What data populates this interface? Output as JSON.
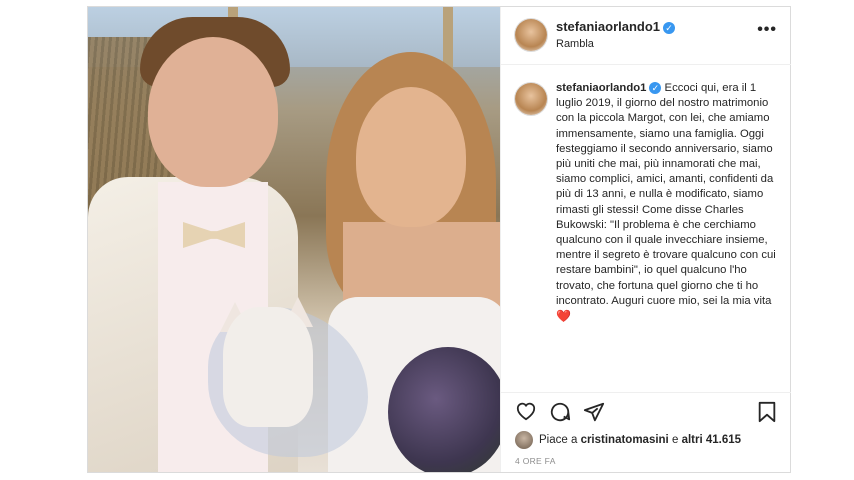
{
  "post": {
    "username": "stefaniaorlando1",
    "location": "Rambla",
    "more_label": "•••",
    "caption": "Eccoci qui, era il 1 luglio 2019, il giorno del nostro matrimonio con la piccola Margot, con lei, che amiamo immensamente, siamo una famiglia. Oggi festeggiamo il secondo anniversario, siamo più uniti che mai, più innamorati che mai, siamo complici, amici, amanti, confidenti da più di 13 anni, e nulla è modificato, siamo rimasti gli stessi! Come disse Charles Bukowski: \"Il problema è che cerchiamo qualcuno con il quale invecchiare insieme, mentre il segreto è trovare qualcuno con cui restare bambini\", io quel qualcuno l'ho trovato, che fortuna quel giorno che ti ho incontrato. Auguri cuore mio, sei la mia vita",
    "caption_emoji": "❤️",
    "likes_prefix": "Piace a",
    "liked_by": "cristinatomasini",
    "likes_middle": "e",
    "likes_others": "altri 41.615",
    "time_ago": "4 ORE FA"
  },
  "icons": [
    "heart-icon",
    "comment-icon",
    "share-icon",
    "bookmark-icon",
    "verified-icon"
  ],
  "colors": {
    "verified": "#3897f0",
    "heart": "#ed4956",
    "border": "#dbdbdb"
  }
}
